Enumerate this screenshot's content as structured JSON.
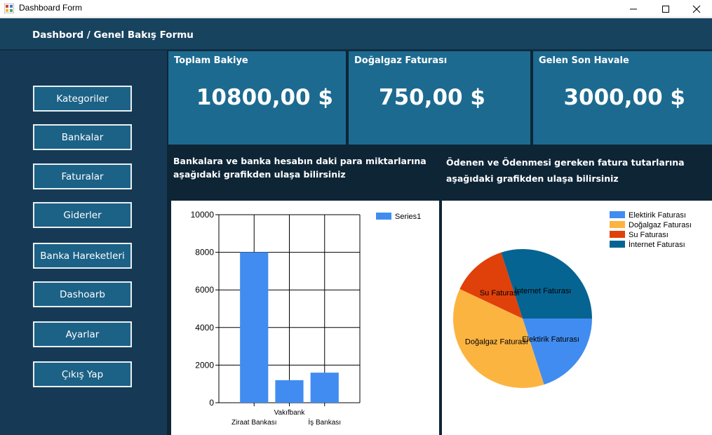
{
  "window": {
    "title": "Dashboard Form"
  },
  "header": {
    "title": "Dashbord / Genel Bakış Formu"
  },
  "sidebar": {
    "items": [
      {
        "label": "Kategoriler"
      },
      {
        "label": "Bankalar"
      },
      {
        "label": "Faturalar"
      },
      {
        "label": "Giderler"
      },
      {
        "label": "Banka Hareketleri"
      },
      {
        "label": "Dashoarb"
      },
      {
        "label": "Ayarlar"
      },
      {
        "label": "Çıkış Yap"
      }
    ]
  },
  "cards": [
    {
      "title": "Toplam Bakiye",
      "value": "10800,00 $"
    },
    {
      "title": "Doğalgaz Faturası",
      "value": "750,00 $"
    },
    {
      "title": "Gelen Son Havale",
      "value": "3000,00 $"
    }
  ],
  "descriptions": {
    "bank": {
      "line1": "Bankalara ve banka hesabın daki para miktarlarına",
      "line2": "aşağıdaki grafikden ulaşa bilirsiniz"
    },
    "bills": {
      "line1": "Ödenen ve Ödenmesi gereken fatura tutarlarına",
      "line2": "aşağıdaki grafikden ulaşa bilirsiniz"
    }
  },
  "colors": {
    "header": "#18435f",
    "sidebar": "#163a55",
    "card": "#1d6a90",
    "main_bg": "#0e2536",
    "bar": "#418cf0"
  },
  "chart_data": [
    {
      "type": "bar",
      "categories": [
        "Ziraat Bankası",
        "Vakıfbank",
        "İş Bankası"
      ],
      "series": [
        {
          "name": "Series1",
          "values": [
            8000,
            1200,
            1600
          ]
        }
      ],
      "ylim": [
        0,
        10000
      ],
      "yticks": [
        0,
        2000,
        4000,
        6000,
        8000,
        10000
      ],
      "grid": true,
      "legend": "top-right"
    },
    {
      "type": "pie",
      "labels": [
        "Elektirik Faturası",
        "Doğalgaz Faturası",
        "Su Faturası",
        "İnternet Faturası"
      ],
      "values": [
        20,
        37,
        13,
        30
      ],
      "colors": [
        "#418cf0",
        "#fcb441",
        "#e0400a",
        "#056492"
      ],
      "legend": "top-right"
    }
  ]
}
